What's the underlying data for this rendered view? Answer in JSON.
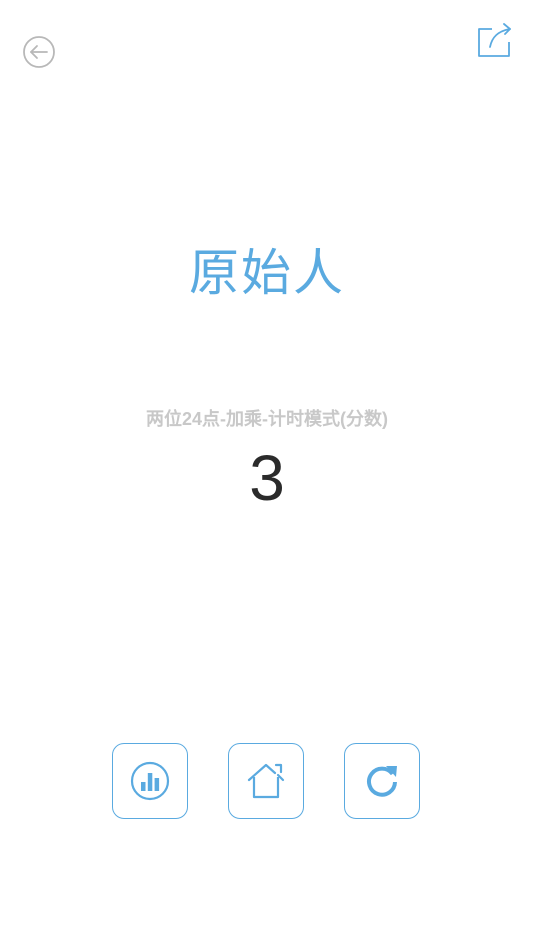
{
  "header": {
    "back_icon": "arrow-left-circle-icon",
    "share_icon": "share-icon"
  },
  "result": {
    "rank_title": "原始人",
    "mode_label": "两位24点-加乘-计时模式(分数)",
    "score": "3"
  },
  "actions": [
    {
      "name": "stats",
      "icon": "bar-chart-icon"
    },
    {
      "name": "home",
      "icon": "home-icon"
    },
    {
      "name": "retry",
      "icon": "refresh-icon"
    }
  ],
  "colors": {
    "accent": "#5aaae0",
    "muted_text": "#c8c8c8",
    "score_text": "#2b2b2b",
    "back_icon": "#b8b8b8"
  }
}
